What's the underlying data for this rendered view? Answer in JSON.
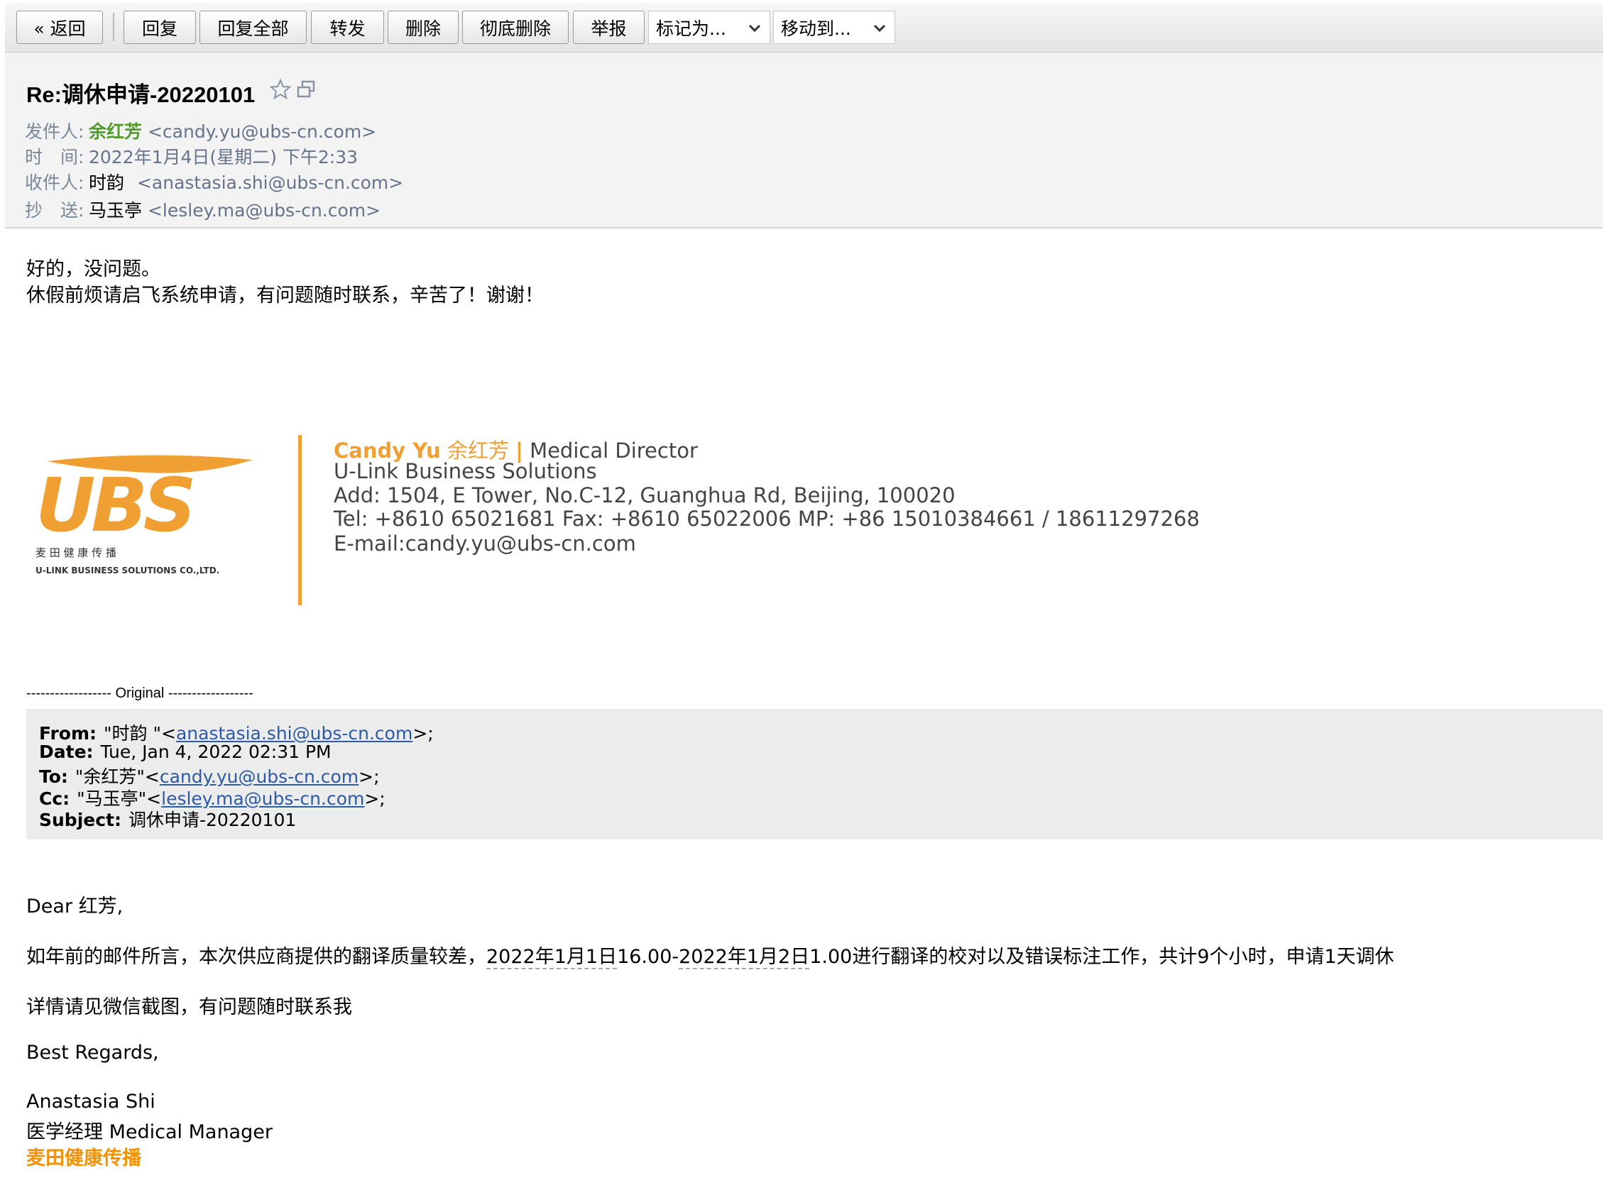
{
  "toolbar": {
    "back": "« 返回",
    "reply": "回复",
    "reply_all": "回复全部",
    "forward": "转发",
    "delete": "删除",
    "delete_permanent": "彻底删除",
    "report": "举报",
    "mark_as": "标记为...",
    "move_to": "移动到..."
  },
  "header": {
    "subject": "Re:调休申请-20220101",
    "from_label": "发件人:",
    "from_name": "余红芳",
    "from_email": "<candy.yu@ubs-cn.com>",
    "time_label": "时　间:",
    "time_value": "2022年1月4日(星期二) 下午2:33",
    "to_label": "收件人:",
    "to_name": "时韵",
    "to_email": "<anastasia.shi@ubs-cn.com>",
    "cc_label": "抄　送:",
    "cc_name": "马玉亭",
    "cc_email": "<lesley.ma@ubs-cn.com>"
  },
  "reply": {
    "line1": "好的，没问题。",
    "line2": "休假前烦请启飞系统申请，有问题随时联系，辛苦了！谢谢！"
  },
  "signature": {
    "name": "Candy Yu",
    "name_cn": "余红芳",
    "sep": "|",
    "title": "Medical Director",
    "company": "U-Link Business Solutions",
    "address": "Add: 1504, E Tower, No.C-12, Guanghua Rd, Beijing, 100020",
    "phones": "Tel: +8610 65021681  Fax: +8610 65022006  MP: +86 15010384661 / 18611297268",
    "email": "E-mail:candy.yu@ubs-cn.com",
    "logo_text": "UBS",
    "logo_cn": "麦  田  健  康  传  播",
    "logo_en": "U-LINK BUSINESS SOLUTIONS CO.,LTD."
  },
  "original": {
    "divider": "------------------ Original ------------------",
    "from_label": "From:",
    "from_name": "\"时韵 \"<",
    "from_email": "anastasia.shi@ubs-cn.com",
    "from_tail": ">;",
    "date_label": "Date:",
    "date_value": "Tue, Jan 4, 2022 02:31 PM",
    "to_label": "To:",
    "to_name": "\"余红芳\"<",
    "to_email": "candy.yu@ubs-cn.com",
    "to_tail": ">;",
    "cc_label": "Cc:",
    "cc_name": "\"马玉亭\"<",
    "cc_email": "lesley.ma@ubs-cn.com",
    "cc_tail": ">;",
    "subject_label": "Subject:",
    "subject_value": "调休申请-20220101"
  },
  "original_body": {
    "greeting": "Dear 红芳,",
    "para1_a": "如年前的邮件所言，本次供应商提供的翻译质量较差，",
    "para1_date1": "2022年1月1日",
    "para1_b": "16.00-",
    "para1_date2": "2022年1月2日",
    "para1_c": "1.00进行翻译的校对以及错误标注工作，共计9个小时，申请1天调休",
    "para2": "详情请见微信截图，有问题随时联系我",
    "regards": "Best Regards,",
    "sig_name": "Anastasia Shi",
    "sig_title": "医学经理 Medical Manager",
    "sig_company": "麦田健康传播"
  }
}
